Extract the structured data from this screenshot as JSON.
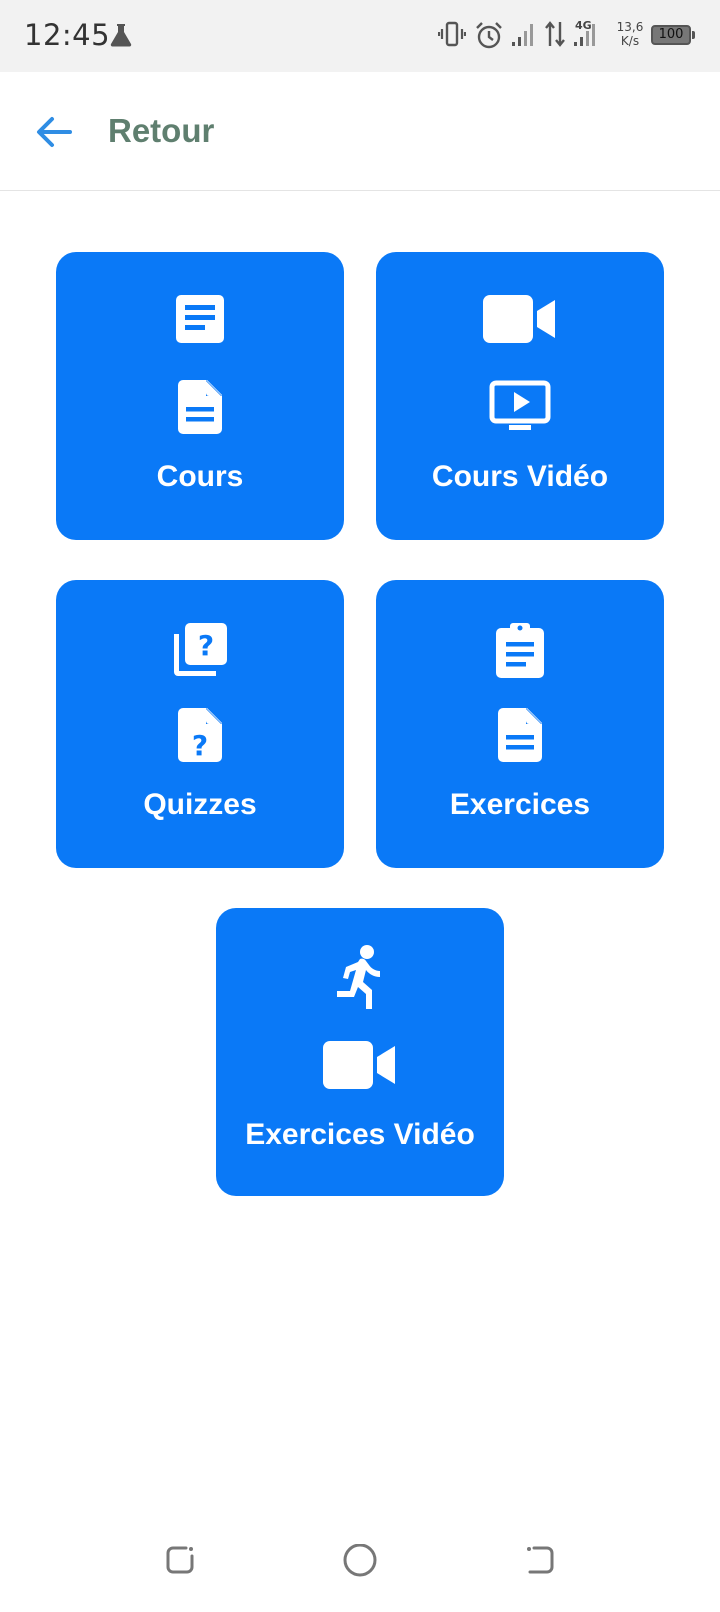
{
  "status_bar": {
    "time": "12:45",
    "network_type": "4G",
    "net_speed_value": "13,6",
    "net_speed_unit": "K/s",
    "battery_level": "100"
  },
  "header": {
    "back_icon": "arrow-left-icon",
    "title": "Retour",
    "accent_color": "#2f8de4",
    "title_color": "#5f7f6f"
  },
  "tiles": [
    {
      "label": "Cours",
      "icons": [
        "article-icon",
        "document-icon"
      ]
    },
    {
      "label": "Cours Vidéo",
      "icons": [
        "video-camera-icon",
        "play-screen-icon"
      ]
    },
    {
      "label": "Quizzes",
      "icons": [
        "quiz-library-icon",
        "quiz-document-icon"
      ]
    },
    {
      "label": "Exercices",
      "icons": [
        "clipboard-icon",
        "document-icon"
      ]
    },
    {
      "label": "Exercices Vidéo",
      "icons": [
        "running-person-icon",
        "video-camera-icon"
      ]
    }
  ],
  "tile_color": "#0a79f7",
  "nav_bar": {
    "buttons": [
      "recents-icon",
      "home-icon",
      "back-icon"
    ]
  }
}
